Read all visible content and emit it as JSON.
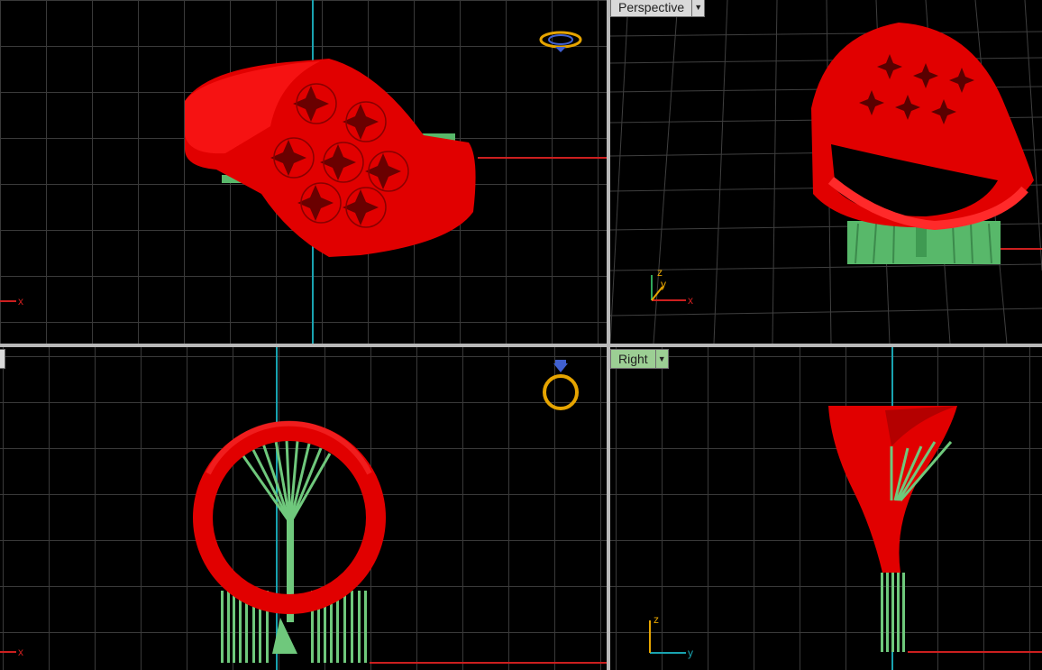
{
  "viewports": {
    "top": {
      "label": ""
    },
    "perspective": {
      "label": "Perspective"
    },
    "front": {
      "label": ""
    },
    "right": {
      "label": "Right"
    }
  },
  "axes": {
    "top": {
      "x": "x"
    },
    "perspective": {
      "x": "x",
      "y": "y",
      "z": "z"
    },
    "front": {
      "x": "x"
    },
    "right": {
      "y": "y",
      "z": "z"
    }
  },
  "icons": {
    "gem_top": "gem-top-view-icon",
    "ring_front": "ring-front-view-icon",
    "dropdown": "chevron-down-icon"
  },
  "colors": {
    "ring": "#e80000",
    "support": "#58b86a",
    "grid": "#3a3a3a",
    "x_axis": "#cc1f1f",
    "y_axis": "#19a3b0",
    "label_active": "#9ccf94",
    "label_inactive": "#d9d9d9"
  }
}
